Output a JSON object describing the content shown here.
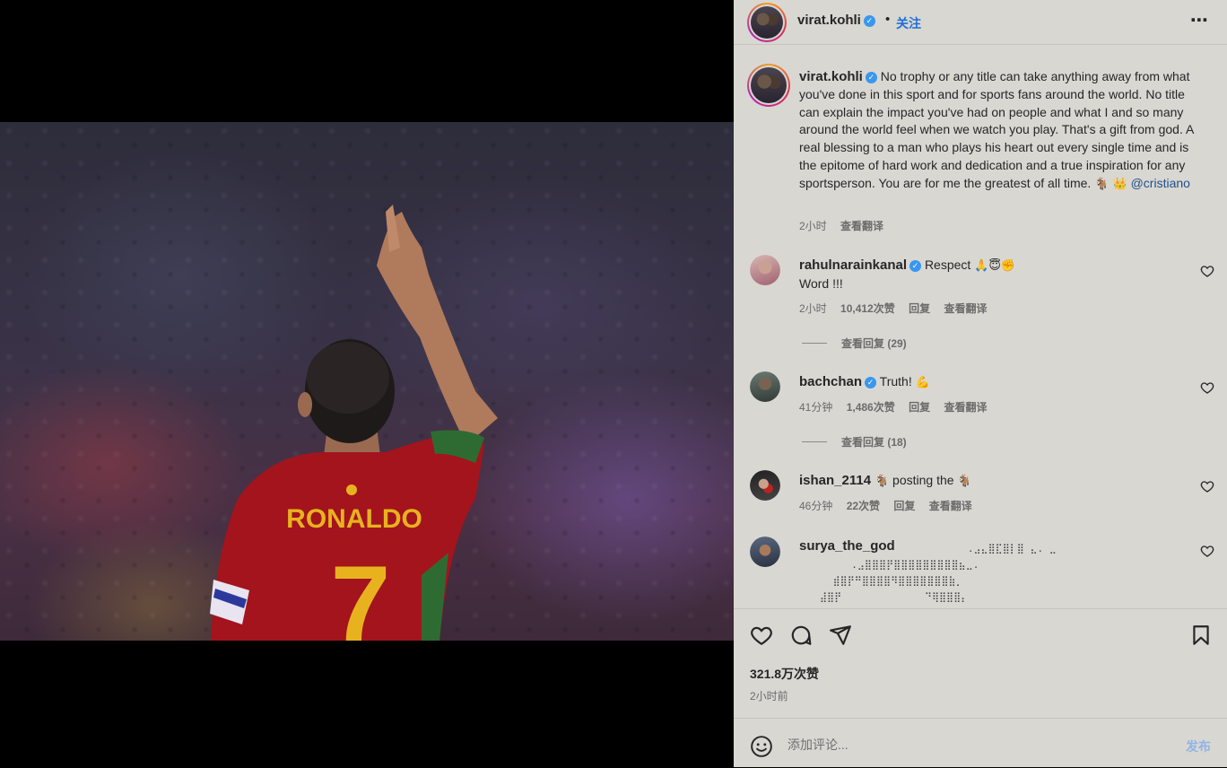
{
  "post": {
    "image_alt_desc": "",
    "jersey_name": "RONALDO",
    "jersey_number": "7"
  },
  "header": {
    "username": "virat.kohli",
    "dot": "•",
    "follow_label": "关注",
    "more_icon": "more-horizontal-icon"
  },
  "caption": {
    "username": "virat.kohli",
    "text": "No trophy or any title can take anything away from what you've done in this sport and for sports fans around the world. No title can explain the impact you've had on people and what I and so many around the world feel when we watch you play. That's a gift from god. A real blessing to a man who plays his heart out every single time and is the epitome of hard work and dedication and a true inspiration for any sportsperson. You are for me the greatest of all time.",
    "emojis": "🐐 👑",
    "mention": "@cristiano",
    "time": "2小时",
    "translate": "查看翻译"
  },
  "comments": [
    {
      "username": "rahulnarainkanal",
      "verified": true,
      "text": "Respect",
      "emojis": "🙏😇✊",
      "text2": "Word !!!",
      "time": "2小时",
      "likes": "10,412次赞",
      "reply": "回复",
      "translate": "查看翻译",
      "view_replies": "查看回复 (29)"
    },
    {
      "username": "bachchan",
      "verified": true,
      "text": "Truth!",
      "emojis": "💪",
      "time": "41分钟",
      "likes": "1,486次赞",
      "reply": "回复",
      "translate": "查看翻译",
      "view_replies": "查看回复 (18)"
    },
    {
      "username": "ishan_2114",
      "verified": false,
      "text_pre": "🐐",
      "text": "posting the",
      "emojis": "🐐",
      "time": "46分钟",
      "likes": "22次赞",
      "reply": "回复",
      "translate": "查看翻译"
    },
    {
      "username": "surya_the_god",
      "verified": false,
      "ascii_lines": [
        "           .⣠⣄⣿⣏⣿⡇⣿ ⣄. ⣀",
        "  .⣠⣿⣿⣿⡟⣿⣿⣿⣿⣿⣿⣿⣿⣿⣦⣀.",
        " ⣾⣿⡟⠛⣿⣿⣿⣿⠻⣿⣿⣿⣿⣿⣿⣿⣷⡀",
        "⣼⣿⡟              ⠙⢿⣿⣿⣿⡄"
      ]
    }
  ],
  "actions": {
    "like_icon": "heart-icon",
    "comment_icon": "comment-icon",
    "share_icon": "share-icon",
    "save_icon": "bookmark-icon",
    "likes_count": "321.8万次赞",
    "post_time": "2小时前"
  },
  "input": {
    "emoji_icon": "smiley-icon",
    "placeholder": "添加评论...",
    "post_label": "发布"
  },
  "colors": {
    "panel_bg": "#d9d7d2",
    "link_blue": "#1f6fd6",
    "post_disabled": "#8fb4e6",
    "verified": "#3897f0",
    "jersey_red": "#a3141d",
    "jersey_gold": "#e8b21f"
  }
}
